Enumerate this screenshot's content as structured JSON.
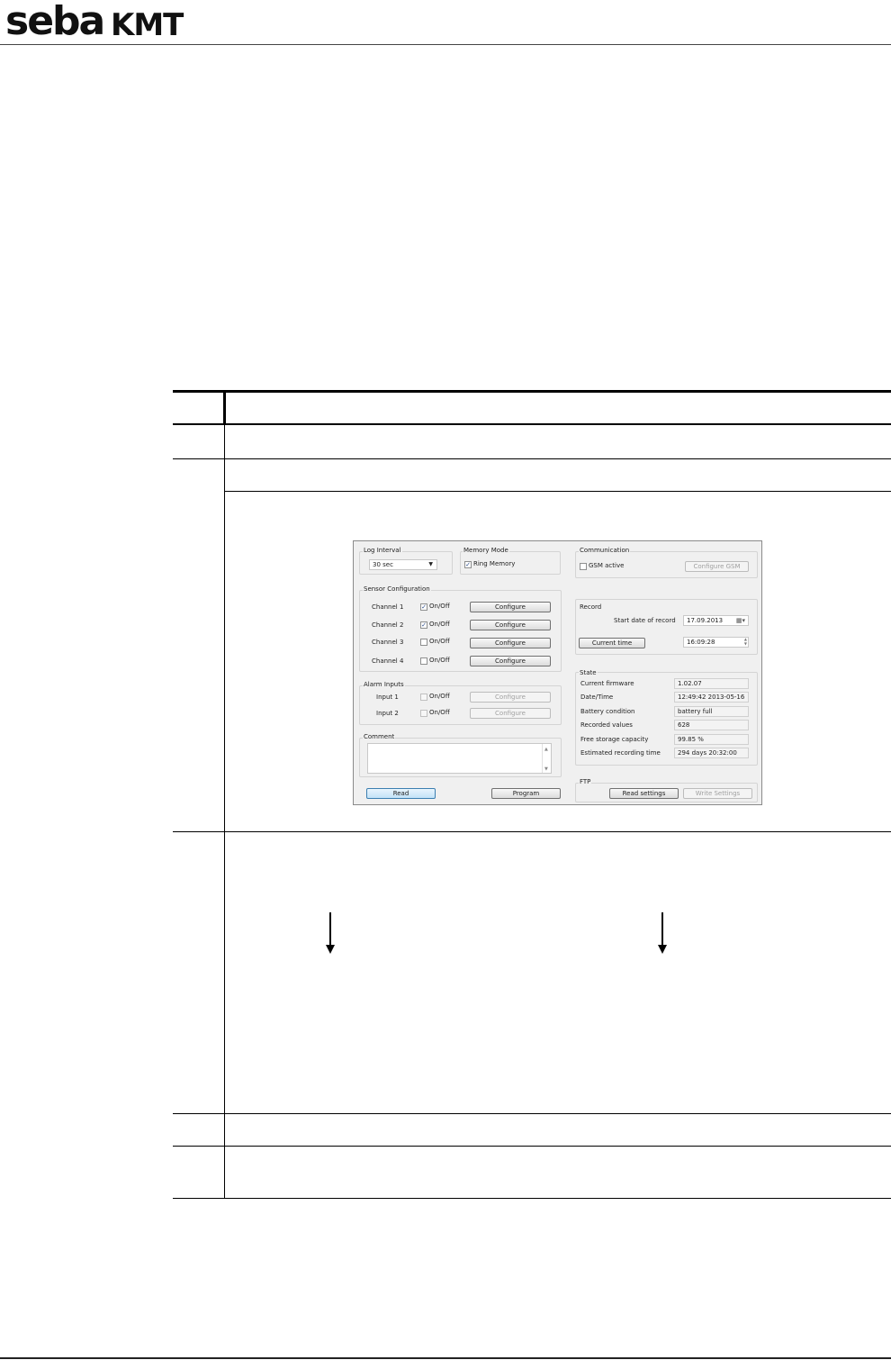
{
  "header": {
    "brand_seba": "seba",
    "brand_kmt": "KMT"
  },
  "dialog": {
    "log_interval": {
      "title": "Log Interval",
      "value": "30 sec"
    },
    "memory_mode": {
      "title": "Memory Mode",
      "ring_memory_label": "Ring Memory",
      "ring_memory_checked": true
    },
    "communication": {
      "title": "Communication",
      "gsm_label": "GSM active",
      "gsm_checked": false,
      "configure_gsm": "Configure GSM"
    },
    "sensor_configuration": {
      "title": "Sensor Configuration",
      "channels": [
        {
          "label": "Channel 1",
          "toggle": "On/Off",
          "checked": true,
          "button": "Configure"
        },
        {
          "label": "Channel 2",
          "toggle": "On/Off",
          "checked": true,
          "button": "Configure"
        },
        {
          "label": "Channel 3",
          "toggle": "On/Off",
          "checked": false,
          "button": "Configure"
        },
        {
          "label": "Channel 4",
          "toggle": "On/Off",
          "checked": false,
          "button": "Configure"
        }
      ]
    },
    "alarm_inputs": {
      "title": "Alarm Inputs",
      "inputs": [
        {
          "label": "Input 1",
          "toggle": "On/Off",
          "checked": false,
          "button": "Configure"
        },
        {
          "label": "Input 2",
          "toggle": "On/Off",
          "checked": false,
          "button": "Configure"
        }
      ]
    },
    "comment": {
      "title": "Comment",
      "value": ""
    },
    "record": {
      "title": "Record",
      "start_date_label": "Start date of record",
      "start_date": "17.09.2013",
      "current_time_button": "Current time",
      "time_value": "16:09:28"
    },
    "state": {
      "title": "State",
      "rows": [
        {
          "label": "Current firmware",
          "value": "1.02.07"
        },
        {
          "label": "Date/Time",
          "value": "12:49:42 2013-05-16"
        },
        {
          "label": "Battery condition",
          "value": "battery full"
        },
        {
          "label": "Recorded values",
          "value": "628"
        },
        {
          "label": "Free storage capacity",
          "value": "99.85 %"
        },
        {
          "label": "Estimated recording time",
          "value": "294 days 20:32:00"
        }
      ]
    },
    "ftp": {
      "title": "FTP",
      "read_settings": "Read settings",
      "write_settings": "Write Settings"
    },
    "read_button": "Read",
    "program_button": "Program"
  }
}
